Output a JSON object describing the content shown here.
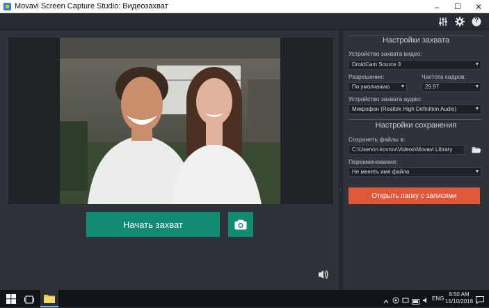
{
  "window": {
    "title": "Movavi Screen Capture Studio: Видеозахват",
    "minimize": "–",
    "maximize": "☐",
    "close": "✕"
  },
  "toolbar": {
    "icons": [
      "equalizer-icon",
      "gear-icon",
      "help-icon"
    ],
    "help_glyph": "?"
  },
  "main": {
    "start_button_label": "Начать захват"
  },
  "capture_settings": {
    "title": "Настройки захвата",
    "video_device_label": "Устройство захвата видео:",
    "video_device_value": "DroidCam Source 3",
    "resolution_label": "Разрешение:",
    "resolution_value": "По умолчанию",
    "framerate_label": "Частота кадров:",
    "framerate_value": "29.97",
    "audio_device_label": "Устройство захвата аудио:",
    "audio_device_value": "Микрофон (Realtek High Definition Audio)"
  },
  "save_settings": {
    "title": "Настройки сохранения",
    "save_path_label": "Сохранять файлы в:",
    "save_path_value": "C:\\Users\\n.kovrov\\Videos\\Movavi Library",
    "rename_label": "Переименование:",
    "rename_value": "Не менять имя файла",
    "open_folder_label": "Открыть папку с записями"
  },
  "taskbar": {
    "language": "ENG",
    "time": "8:50 AM",
    "date": "15/10/2018"
  },
  "colors": {
    "accent_green": "#138a73",
    "accent_orange": "#e0583a",
    "panel_bg": "#2e333a"
  }
}
